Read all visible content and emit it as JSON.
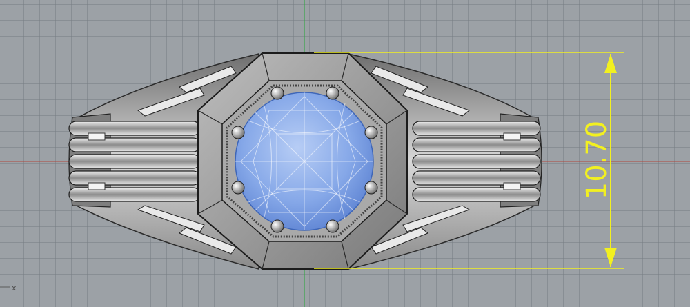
{
  "viewport": {
    "dimension_value": "10.70",
    "axis_label": "x",
    "colors": {
      "background": "#9ca1a6",
      "x_axis": "#b0463c",
      "y_axis": "#3aa64a",
      "dimension": "#f2f020",
      "gem": "#7aa3e6",
      "metal": "#9b9b9b"
    }
  }
}
